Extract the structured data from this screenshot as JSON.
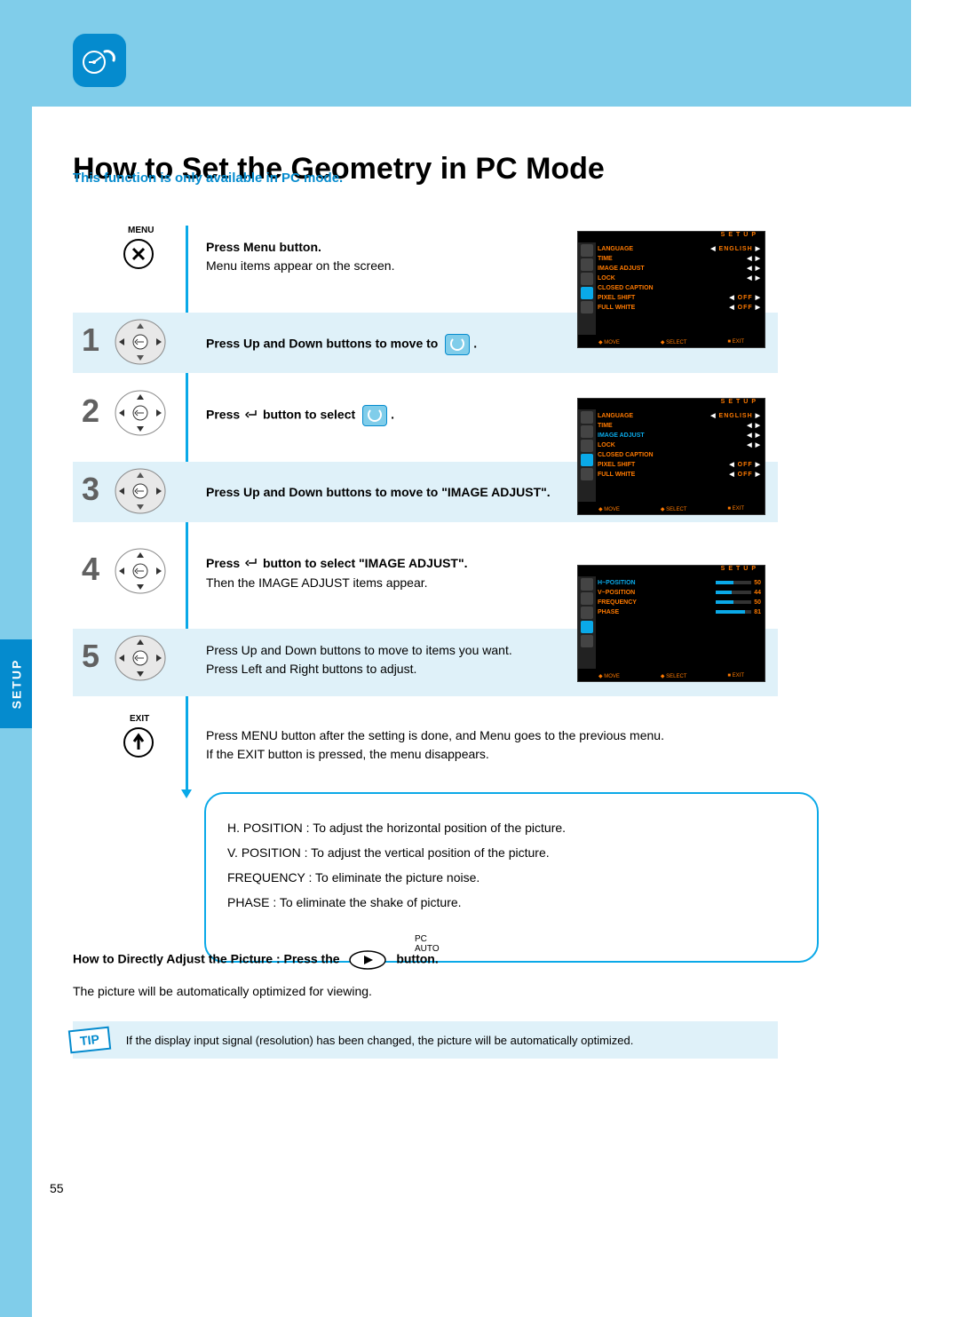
{
  "header": {
    "title": "How to Set the Geometry in PC Mode",
    "subtitle": "This function is only available in PC mode."
  },
  "sidebar": {
    "tab": "SETUP",
    "page": "55"
  },
  "buttons": {
    "menu_label": "MENU",
    "exit_label": "EXIT",
    "pc_auto_label": "PC AUTO"
  },
  "steps": {
    "s0": {
      "line1": "Press Menu button.",
      "line2": "Menu items appear on the screen."
    },
    "s1": {
      "num": "1",
      "line1": "Press Up and Down buttons to move to"
    },
    "s2": {
      "num": "2",
      "line1_a": "Press",
      "line1_b": "button to select"
    },
    "s3": {
      "num": "3",
      "line1": "Press Up and Down buttons to move to \"IMAGE ADJUST\"."
    },
    "s4": {
      "num": "4",
      "line1_a": "Press",
      "line1_b": "button to select \"IMAGE ADJUST\".",
      "line2": "Then the IMAGE ADJUST items appear."
    },
    "s5": {
      "num": "5",
      "line1": "Press Up and Down buttons to move to items you want.",
      "line2": "Press Left and Right buttons to adjust."
    },
    "s6": {
      "line1": "Press MENU button after the setting is done, and Menu goes to the previous menu.",
      "line2": "If the EXIT button is pressed, the menu disappears."
    }
  },
  "info": {
    "l1": "H. POSITION : To adjust the horizontal position of the picture.",
    "l2": "V. POSITION : To adjust the vertical position of the picture.",
    "l3": "FREQUENCY : To eliminate the picture noise.",
    "l4": "PHASE : To eliminate the shake of picture."
  },
  "direct": {
    "prefix": "How to Directly Adjust the Picture : Press the",
    "suffix": "button.",
    "auto": "The picture will be automatically optimized for viewing."
  },
  "tip": {
    "label": "TIP",
    "text": "If the display input signal (resolution) has been changed, the picture will be automatically optimized."
  },
  "osd": {
    "title": "SETUP",
    "menu1": {
      "r1": {
        "label": "LANGUAGE",
        "val": "ENGLISH"
      },
      "r2": {
        "label": "TIME"
      },
      "r3": {
        "label": "IMAGE  ADJUST"
      },
      "r4": {
        "label": "LOCK"
      },
      "r5": {
        "label": "CLOSED  CAPTION"
      },
      "r6": {
        "label": "PIXEL  SHIFT",
        "val": "OFF"
      },
      "r7": {
        "label": "FULL  WHITE",
        "val": "OFF"
      }
    },
    "menu3": {
      "r1": {
        "label": "H~POSITION",
        "val": "50"
      },
      "r2": {
        "label": "V~POSITION",
        "val": "44"
      },
      "r3": {
        "label": "FREQUENCY",
        "val": "50"
      },
      "r4": {
        "label": "PHASE",
        "val": "81"
      }
    },
    "foot": {
      "move": "MOVE",
      "select": "SELECT",
      "exit": "EXIT"
    }
  }
}
